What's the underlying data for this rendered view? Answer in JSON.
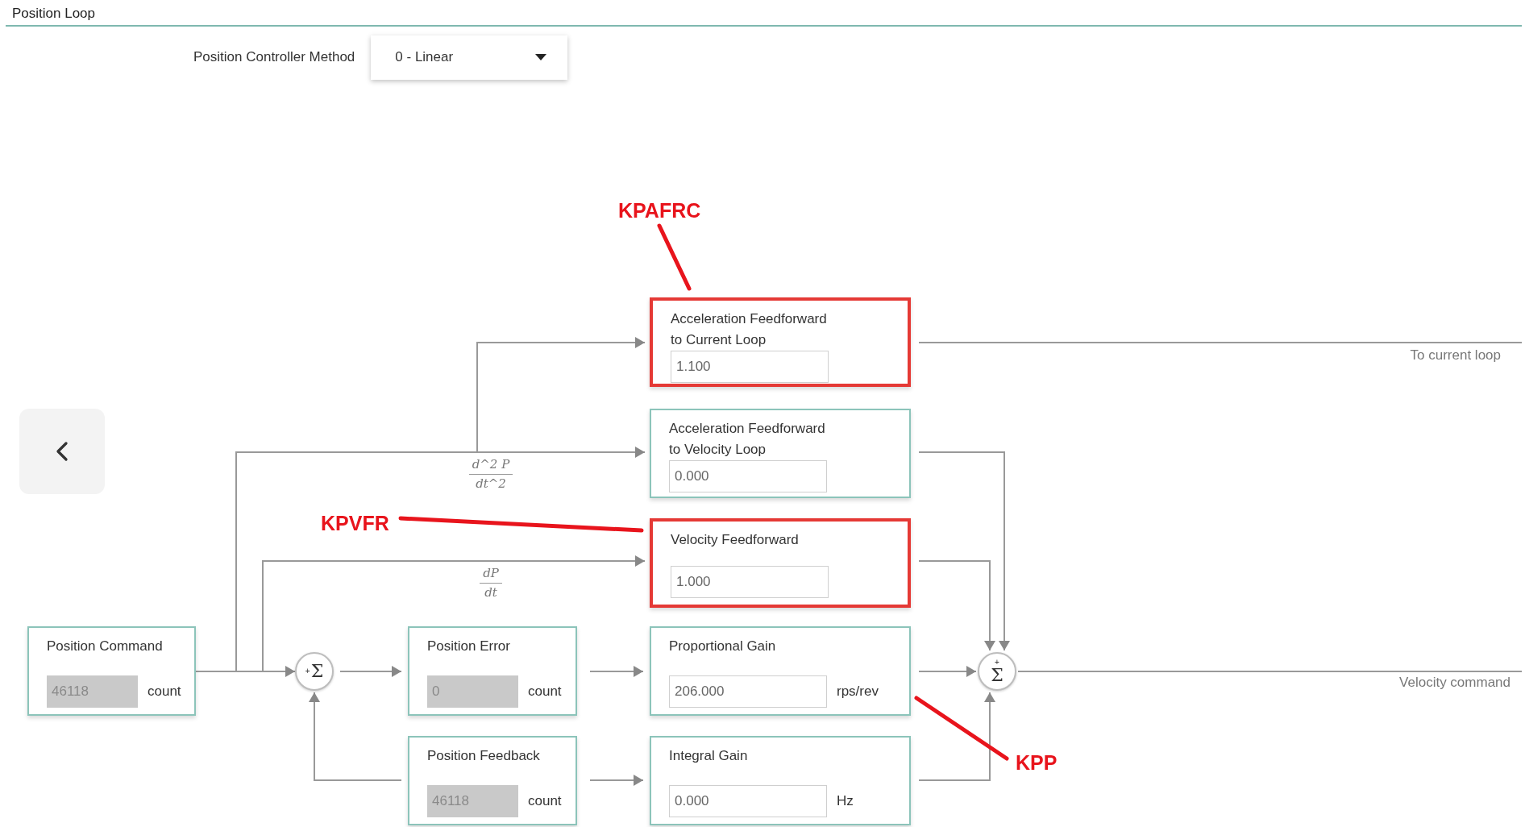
{
  "section": {
    "title": "Position Loop"
  },
  "controller_method": {
    "label": "Position Controller Method",
    "value": "0 - Linear"
  },
  "blocks": [
    {
      "kind": "gain",
      "title_lines": [
        "Acceleration Feedforward",
        "to Current Loop"
      ],
      "value": "1.100",
      "highlighted": true
    },
    {
      "kind": "gain",
      "title_lines": [
        "Acceleration Feedforward",
        "to Velocity Loop"
      ],
      "value": "0.000",
      "highlighted": false
    },
    {
      "kind": "gain",
      "title_lines": [
        "Velocity Feedforward"
      ],
      "value": "1.000",
      "highlighted": true
    },
    {
      "kind": "readout",
      "title_lines": [
        "Position Command"
      ],
      "value": "46118",
      "unit": "count",
      "highlighted": false
    },
    {
      "kind": "readout",
      "title_lines": [
        "Position Error"
      ],
      "value": "0",
      "unit": "count",
      "highlighted": false
    },
    {
      "kind": "gain",
      "title_lines": [
        "Proportional Gain"
      ],
      "value": "206.000",
      "unit": "rps/rev",
      "highlighted": false
    },
    {
      "kind": "readout",
      "title_lines": [
        "Position Feedback"
      ],
      "value": "46118",
      "unit": "count",
      "highlighted": false
    },
    {
      "kind": "gain",
      "title_lines": [
        "Integral Gain"
      ],
      "value": "0.000",
      "unit": "Hz",
      "highlighted": false
    }
  ],
  "sum_nodes": [
    {
      "symbol": "Σ",
      "sign": "+"
    },
    {
      "symbol": "Σ",
      "sign": "+"
    }
  ],
  "derivatives": [
    {
      "numerator": "d^2 P",
      "denominator": "dt^2"
    },
    {
      "numerator": "dP",
      "denominator": "dt"
    }
  ],
  "outputs": [
    {
      "label": "To current loop"
    },
    {
      "label": "Velocity command"
    }
  ],
  "annotations": [
    {
      "text": "KPAFRC"
    },
    {
      "text": "KPVFR"
    },
    {
      "text": "KPP"
    }
  ]
}
